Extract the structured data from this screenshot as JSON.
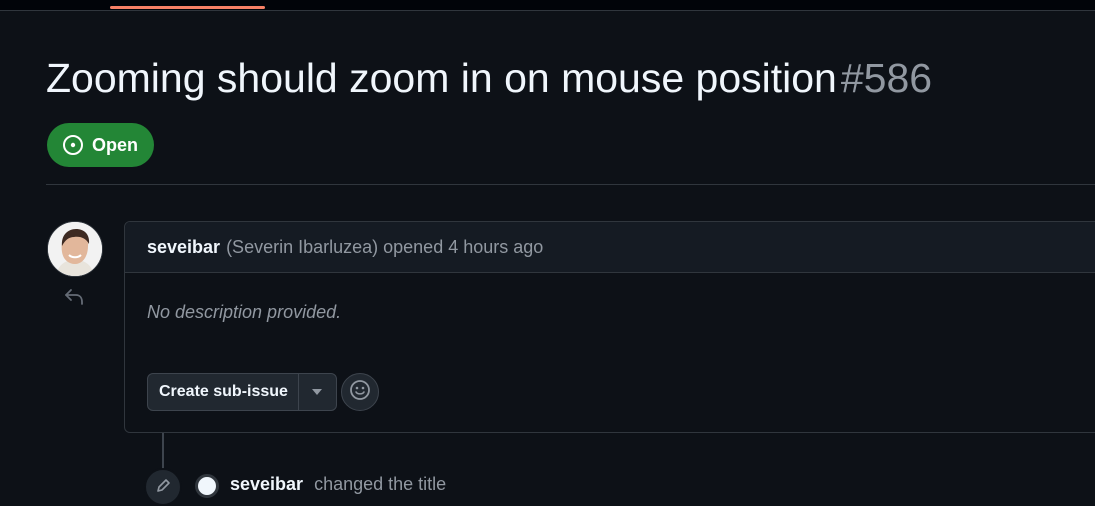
{
  "issue": {
    "title": "Zooming should zoom in on mouse position",
    "number": "#586",
    "state": "Open",
    "state_color": "#238636",
    "state_icon": "issue-opened-icon"
  },
  "colors": {
    "background": "#0d1117",
    "active_tab_underline": "#f78166",
    "border": "#30363d"
  },
  "comment": {
    "author_login": "seveibar",
    "author_fullname": "(Severin Ibarluzea)",
    "opened_text": "opened",
    "timestamp": "4 hours ago",
    "body": "No description provided.",
    "create_subissue_label": "Create sub-issue",
    "reaction_icon": "smiley-icon",
    "reply_icon": "reply-icon"
  },
  "timeline_event": {
    "icon": "pencil-icon",
    "actor": "seveibar",
    "text": "changed the title"
  }
}
